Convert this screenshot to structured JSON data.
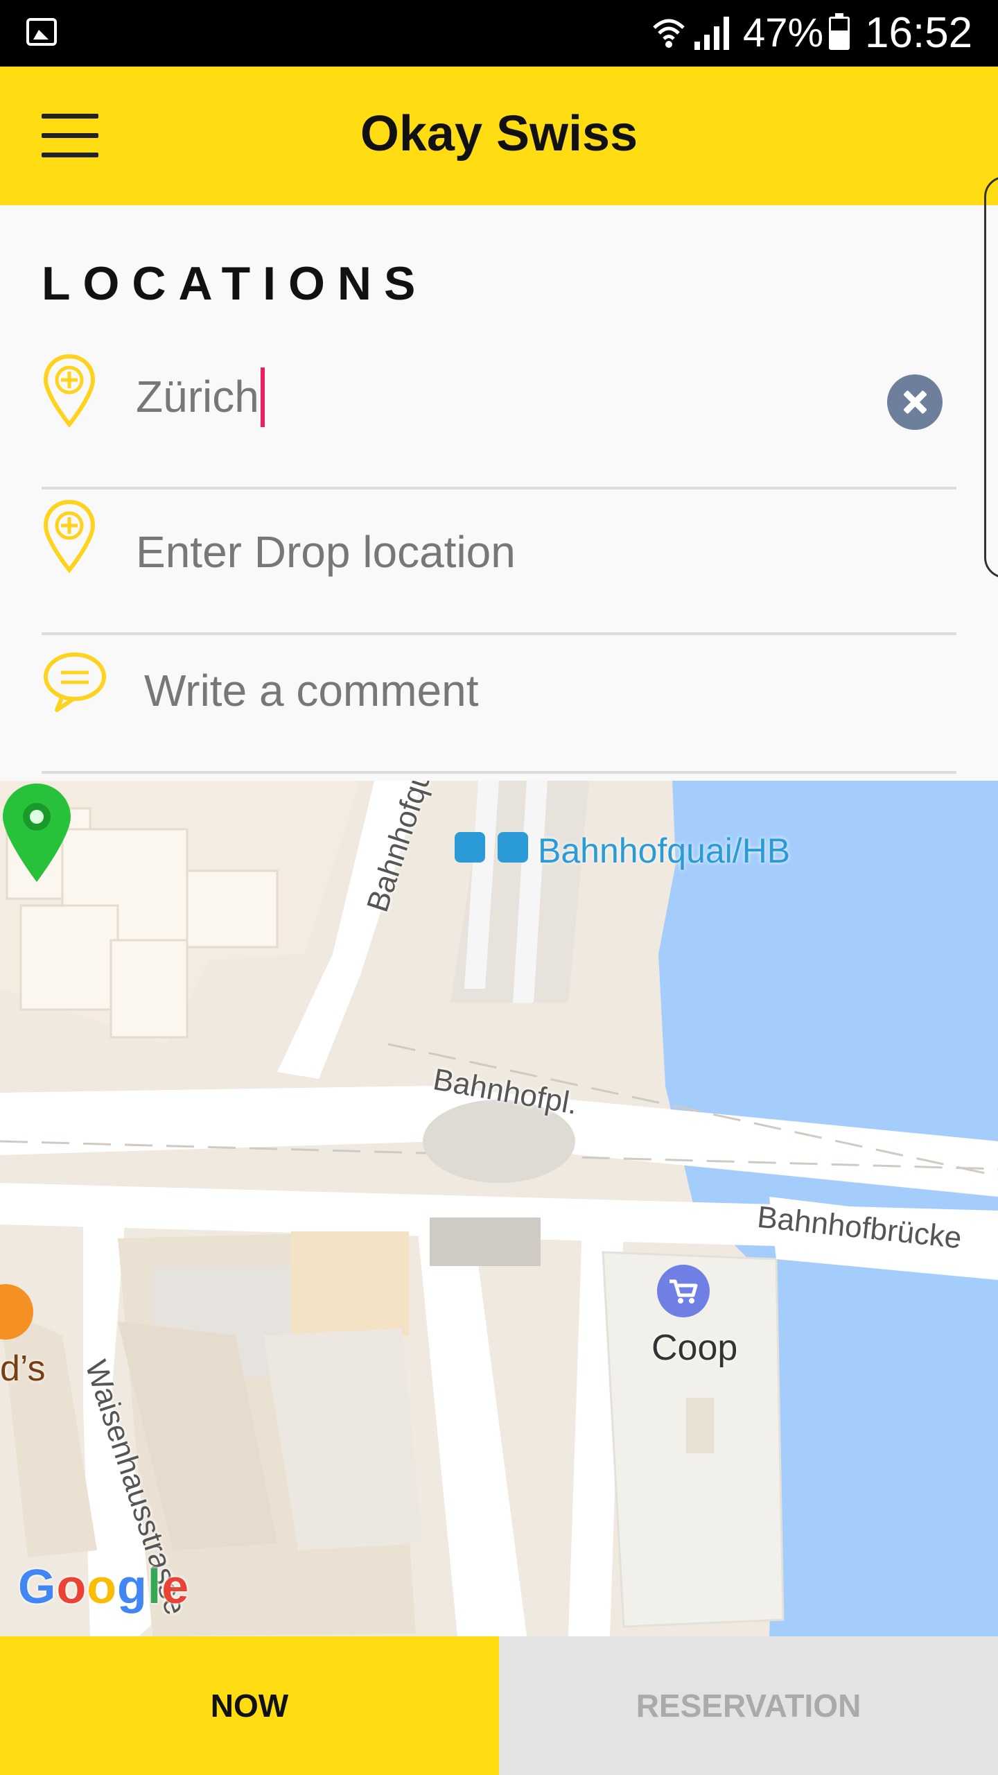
{
  "status_bar": {
    "battery_percent": "47%",
    "time": "16:52",
    "icons": [
      "gallery-icon",
      "wifi-icon",
      "signal-icon",
      "battery-icon"
    ]
  },
  "app_bar": {
    "title": "Okay Swiss",
    "menu_icon": "hamburger-menu-icon"
  },
  "locations": {
    "section_title": "LOCATIONS",
    "pickup": {
      "value": "Zürich",
      "icon": "add-location-pin-icon"
    },
    "drop": {
      "placeholder": "Enter Drop location",
      "icon": "add-location-pin-icon"
    },
    "comment": {
      "placeholder": "Write a comment",
      "icon": "chat-bubble-icon"
    }
  },
  "map": {
    "transit_stop": "Bahnhofquai/HB",
    "streets": [
      "Bahnhofquai",
      "Bahnhofpl.",
      "Bahnhofbrücke",
      "Waisenhausstrasse"
    ],
    "poi_shop": "Coop",
    "poi_restaurant_partial": "d’s",
    "logo": [
      "G",
      "o",
      "o",
      "g",
      "l",
      "e"
    ],
    "marker_color": "#27c23a",
    "water_color": "#a5cdfc"
  },
  "bottom_actions": {
    "now_label": "NOW",
    "reservation_label": "RESERVATION"
  },
  "colors": {
    "brand_yellow": "#ffdd12",
    "accent_pink": "#e91e63",
    "clear_button": "#6d7f9a"
  }
}
